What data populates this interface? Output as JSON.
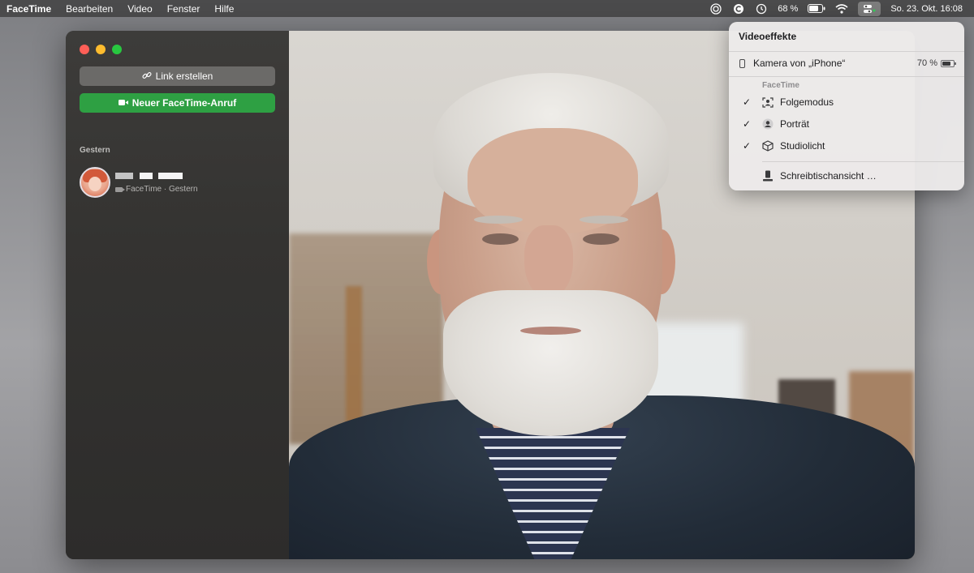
{
  "menubar": {
    "app": "FaceTime",
    "items": [
      "Bearbeiten",
      "Video",
      "Fenster",
      "Hilfe"
    ],
    "battery": "68 %",
    "datetime": "So. 23. Okt.  16:08"
  },
  "sidebar": {
    "link_button": "Link erstellen",
    "call_button": "Neuer FaceTime-Anruf",
    "section": "Gestern",
    "recent_call": {
      "subtitle": "FaceTime · Gestern"
    }
  },
  "popover": {
    "title": "Videoeffekte",
    "camera": {
      "label": "Kamera von „iPhone“",
      "battery": "70 %"
    },
    "group": "FaceTime",
    "effects": [
      {
        "label": "Folgemodus",
        "checked": true,
        "icon": "center-stage-icon"
      },
      {
        "label": "Porträt",
        "checked": true,
        "icon": "portrait-icon"
      },
      {
        "label": "Studiolicht",
        "checked": true,
        "icon": "cube-icon"
      }
    ],
    "desk_view": "Schreibtischansicht …"
  },
  "colors": {
    "accent_green": "#2ea043",
    "traffic_red": "#fe5f57",
    "traffic_yellow": "#febc2e",
    "traffic_green": "#28c840"
  }
}
